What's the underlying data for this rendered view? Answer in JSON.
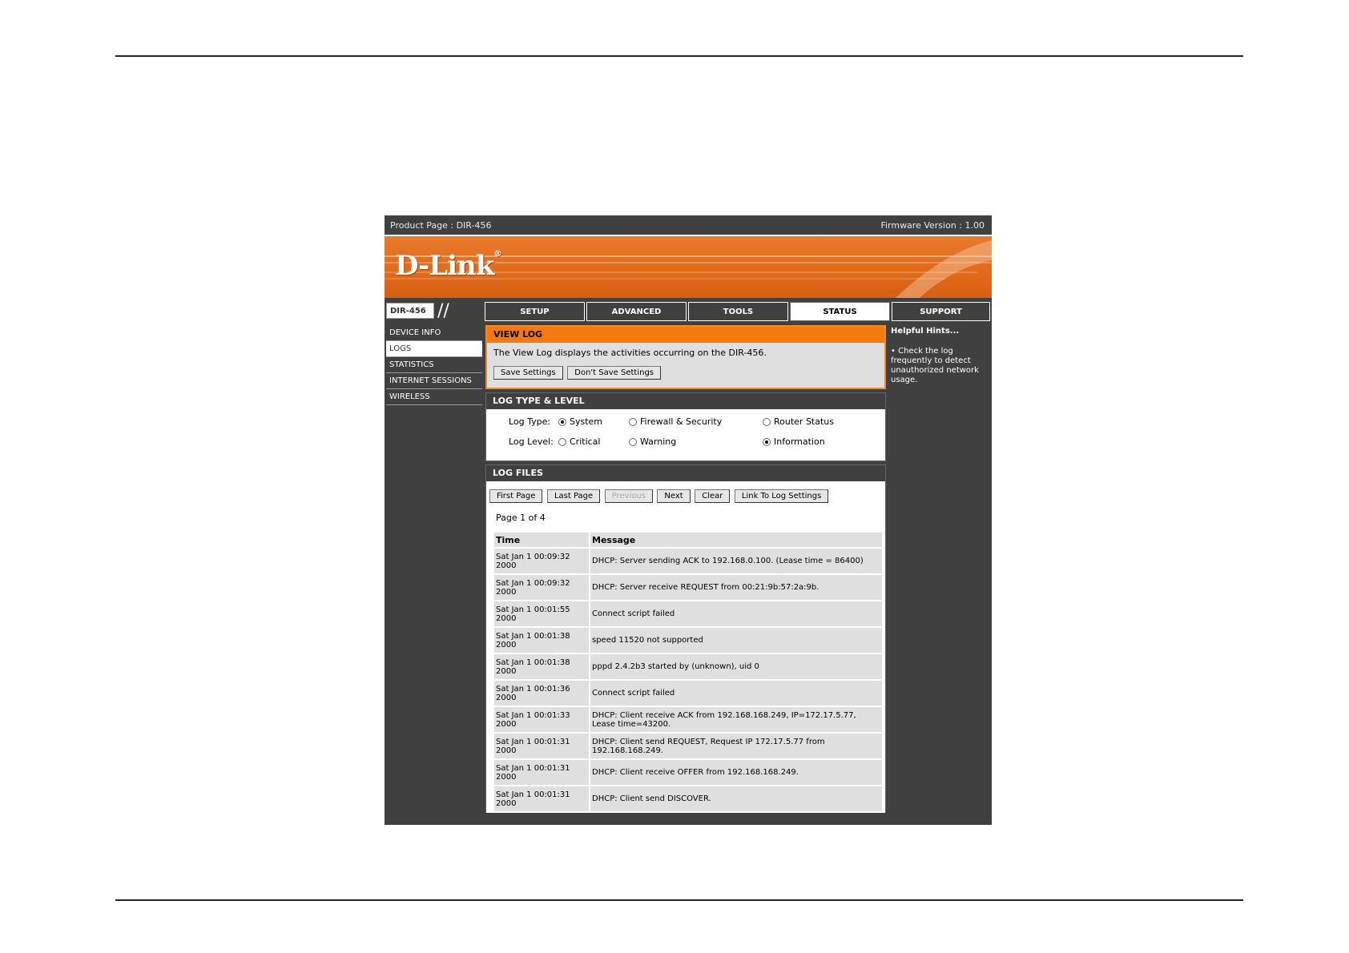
{
  "topbar": {
    "product": "Product Page : DIR-456",
    "firmware": "Firmware Version : 1.00"
  },
  "banner": {
    "logo": "D-Link",
    "reg": "®"
  },
  "nav": {
    "model": "DIR-456",
    "slashes": "//",
    "tabs": [
      {
        "label": "SETUP"
      },
      {
        "label": "ADVANCED"
      },
      {
        "label": "TOOLS"
      },
      {
        "label": "STATUS"
      },
      {
        "label": "SUPPORT"
      }
    ],
    "active_tab": "STATUS"
  },
  "sidebar": {
    "items": [
      {
        "label": "DEVICE INFO"
      },
      {
        "label": "LOGS"
      },
      {
        "label": "STATISTICS"
      },
      {
        "label": "INTERNET SESSIONS"
      },
      {
        "label": "WIRELESS"
      }
    ],
    "active_item": "LOGS"
  },
  "view_log": {
    "title": "VIEW LOG",
    "description": "The View Log displays the activities occurring on the DIR-456.",
    "save_label": "Save Settings",
    "dont_save_label": "Don't Save Settings"
  },
  "log_type_level": {
    "title": "LOG TYPE & LEVEL",
    "type_label": "Log Type:",
    "types": [
      "System",
      "Firewall & Security",
      "Router Status"
    ],
    "selected_type": "System",
    "level_label": "Log Level:",
    "levels": [
      "Critical",
      "Warning",
      "Information"
    ],
    "selected_level": "Information"
  },
  "log_files": {
    "title": "LOG FILES",
    "buttons": {
      "first": "First Page",
      "last": "Last Page",
      "previous": "Previous",
      "next": "Next",
      "clear": "Clear",
      "link": "Link To Log Settings"
    },
    "page_info": "Page 1 of 4",
    "columns": {
      "time": "Time",
      "message": "Message"
    },
    "rows": [
      {
        "time1": "Sat Jan 1 00:09:32",
        "time2": "2000",
        "message": "DHCP: Server sending ACK to 192.168.0.100. (Lease time = 86400)"
      },
      {
        "time1": "Sat Jan 1 00:09:32",
        "time2": "2000",
        "message": "DHCP: Server receive REQUEST from 00:21:9b:57:2a:9b."
      },
      {
        "time1": "Sat Jan 1 00:01:55",
        "time2": "2000",
        "message": "Connect script failed"
      },
      {
        "time1": "Sat Jan 1 00:01:38",
        "time2": "2000",
        "message": "speed 11520 not supported"
      },
      {
        "time1": "Sat Jan 1 00:01:38",
        "time2": "2000",
        "message": "pppd 2.4.2b3 started by (unknown), uid 0"
      },
      {
        "time1": "Sat Jan 1 00:01:36",
        "time2": "2000",
        "message": "Connect script failed"
      },
      {
        "time1": "Sat Jan 1 00:01:33",
        "time2": "2000",
        "message": "DHCP: Client receive ACK from 192.168.168.249, IP=172.17.5.77, Lease time=43200."
      },
      {
        "time1": "Sat Jan 1 00:01:31",
        "time2": "2000",
        "message": "DHCP: Client send REQUEST, Request IP 172.17.5.77 from 192.168.168.249."
      },
      {
        "time1": "Sat Jan 1 00:01:31",
        "time2": "2000",
        "message": "DHCP: Client receive OFFER from 192.168.168.249."
      },
      {
        "time1": "Sat Jan 1 00:01:31",
        "time2": "2000",
        "message": "DHCP: Client send DISCOVER."
      }
    ]
  },
  "hints": {
    "title": "Helpful Hints...",
    "bullet": "•",
    "text": "Check the log frequently to detect unauthorized network usage."
  }
}
